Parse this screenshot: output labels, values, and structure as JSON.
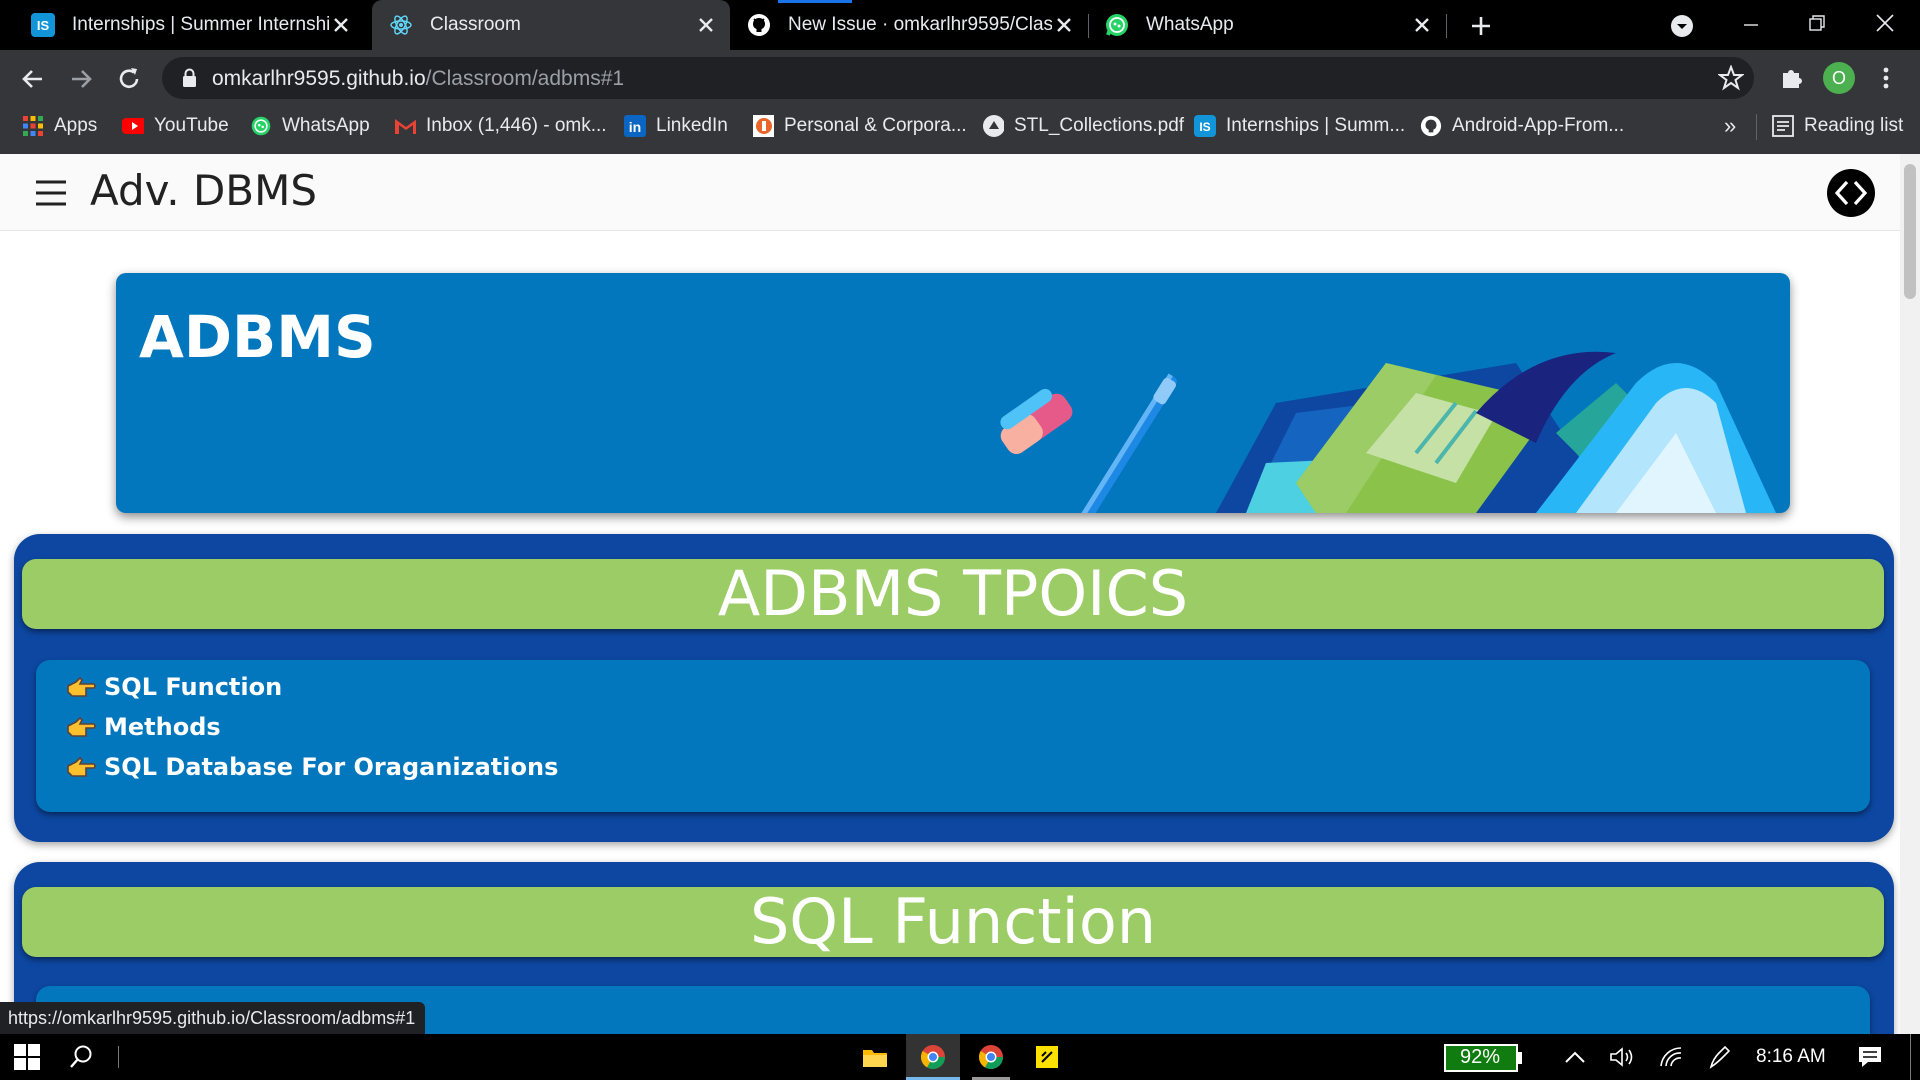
{
  "browser": {
    "tabs": [
      {
        "title": "Internships | Summer Internship",
        "icon": "internshala-icon",
        "active": false
      },
      {
        "title": "Classroom",
        "icon": "react-atom-icon",
        "active": true
      },
      {
        "title": "New Issue · omkarlhr9595/Classr",
        "icon": "github-icon",
        "active": false
      },
      {
        "title": "WhatsApp",
        "icon": "whatsapp-icon",
        "active": false
      }
    ],
    "address": {
      "host": "omkarlhr9595.github.io",
      "path": "/Classroom/adbms#1"
    },
    "profile_initial": "O",
    "bookmarks": [
      {
        "label": "Apps",
        "icon": "apps-grid-icon"
      },
      {
        "label": "YouTube",
        "icon": "youtube-icon"
      },
      {
        "label": "WhatsApp",
        "icon": "whatsapp-icon"
      },
      {
        "label": "Inbox (1,446) - omk...",
        "icon": "gmail-icon"
      },
      {
        "label": "LinkedIn",
        "icon": "linkedin-icon"
      },
      {
        "label": "Personal & Corpora...",
        "icon": "bank-icon"
      },
      {
        "label": "STL_Collections.pdf",
        "icon": "drive-icon"
      },
      {
        "label": "Internships | Summ...",
        "icon": "internshala-icon"
      },
      {
        "label": "Android-App-From...",
        "icon": "github-icon"
      }
    ],
    "bookmarks_overflow": "»",
    "reading_list": "Reading list"
  },
  "page": {
    "appbar_title": "Adv. DBMS",
    "banner_title": "ADBMS",
    "topics_section": {
      "header": "ADBMS TPOICS",
      "items": [
        "SQL Function",
        "Methods",
        "SQL Database For Oraganizations"
      ]
    },
    "sql_section": {
      "header": "SQL Function"
    }
  },
  "status_url": "https://omkarlhr9595.github.io/Classroom/adbms#1",
  "taskbar": {
    "battery": "92%",
    "time": "8:16 AM"
  },
  "colors": {
    "banner": "#0277bd",
    "section": "#0d47a1",
    "header": "#9ccc65",
    "topic_body": "#0277bd"
  }
}
